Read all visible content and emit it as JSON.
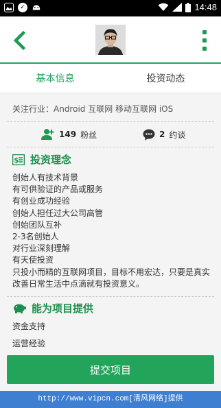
{
  "status_bar": {
    "time": "14:48"
  },
  "tabs": [
    {
      "label": "基本信息",
      "active": true
    },
    {
      "label": "投资动态",
      "active": false
    }
  ],
  "industry": "关注行业：Android 互联网 移动互联网 iOS",
  "stats": {
    "fans_count": "149",
    "fans_label": "粉丝",
    "appointments_count": "2",
    "appointments_label": "约谈"
  },
  "philosophy": {
    "title": "投资理念",
    "items": [
      "创始人有技术背景",
      "有可供验证的产品或服务",
      "有创业成功经验",
      "创始人担任过大公司高管",
      "创始团队互补",
      "2-3名创始人",
      "对行业深刻理解",
      "有天使投资",
      "只投小而精的互联网项目，目标不用宏达，只要是真实改善日常生活中点滴就有投资意义。"
    ]
  },
  "provide": {
    "title": "能为项目提供",
    "items": [
      "资金支持",
      "运营经验"
    ]
  },
  "submit_label": "提交项目",
  "watermark": "http://www.vipcn.com[清风网络]提供",
  "colors": {
    "accent": "#22a45a",
    "watermark_bar": "#3e7fd2"
  }
}
